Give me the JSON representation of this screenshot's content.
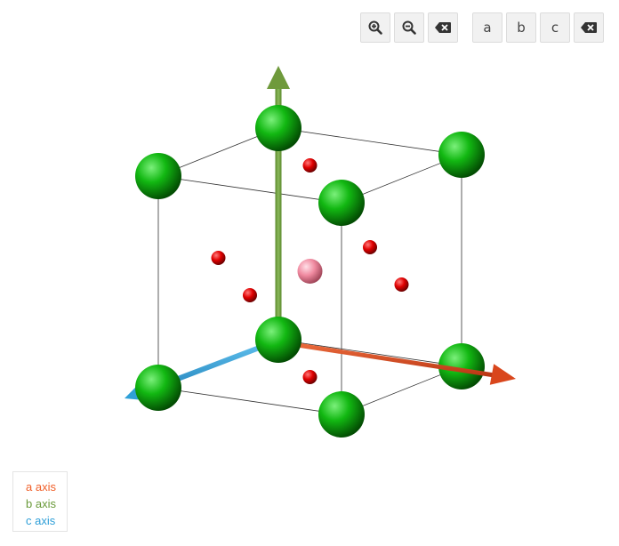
{
  "toolbar": {
    "zoom_in_icon": "zoom-in-icon",
    "zoom_out_icon": "zoom-out-icon",
    "reset_icon": "backspace-icon",
    "axis_a_label": "a",
    "axis_b_label": "b",
    "axis_c_label": "c",
    "clear_icon": "backspace-icon"
  },
  "legend": {
    "a": {
      "label": "a axis",
      "color": "#f0602a"
    },
    "b": {
      "label": "b axis",
      "color": "#6a9a3a"
    },
    "c": {
      "label": "c axis",
      "color": "#2f9fd8"
    }
  },
  "colors": {
    "large_atom": "#0fb40f",
    "small_atom": "#e00000",
    "center_atom": "#f08aa0",
    "axis_a": "#d9461c",
    "axis_b": "#6f9a3c",
    "axis_c": "#2fa0d8",
    "cell_edges": "#333333"
  },
  "structure": {
    "large_atoms": [
      [
        0,
        0,
        0
      ],
      [
        1,
        0,
        0
      ],
      [
        0,
        1,
        0
      ],
      [
        0,
        0,
        1
      ],
      [
        1,
        1,
        0
      ],
      [
        1,
        0,
        1
      ],
      [
        0,
        1,
        1
      ],
      [
        1,
        1,
        1
      ]
    ],
    "small_atoms": [
      [
        0.5,
        0,
        0.5
      ],
      [
        0.5,
        1,
        0.5
      ],
      [
        0,
        0.5,
        0.5
      ],
      [
        1,
        0.5,
        0.5
      ],
      [
        0.5,
        0.5,
        0
      ],
      [
        0.5,
        0.5,
        1
      ]
    ],
    "center_atoms": [
      [
        0.5,
        0.5,
        0.5
      ]
    ]
  }
}
